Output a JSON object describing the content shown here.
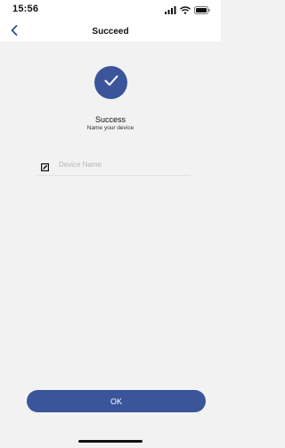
{
  "status_bar": {
    "time": "15:56",
    "icons": [
      "signal-icon",
      "wifi-icon",
      "battery-icon"
    ]
  },
  "nav": {
    "back_icon": "chevron-left-icon",
    "title": "Succeed"
  },
  "success": {
    "icon": "checkmark-icon",
    "title": "Success",
    "subtitle": "Name your device"
  },
  "device_name": {
    "icon": "edit-icon",
    "value": "",
    "placeholder": "Device Name"
  },
  "ok_button": {
    "label": "OK"
  },
  "colors": {
    "accent": "#3a559a",
    "back_arrow": "#2e4d92",
    "background": "#f2f2f2",
    "header_background": "#ffffff"
  }
}
